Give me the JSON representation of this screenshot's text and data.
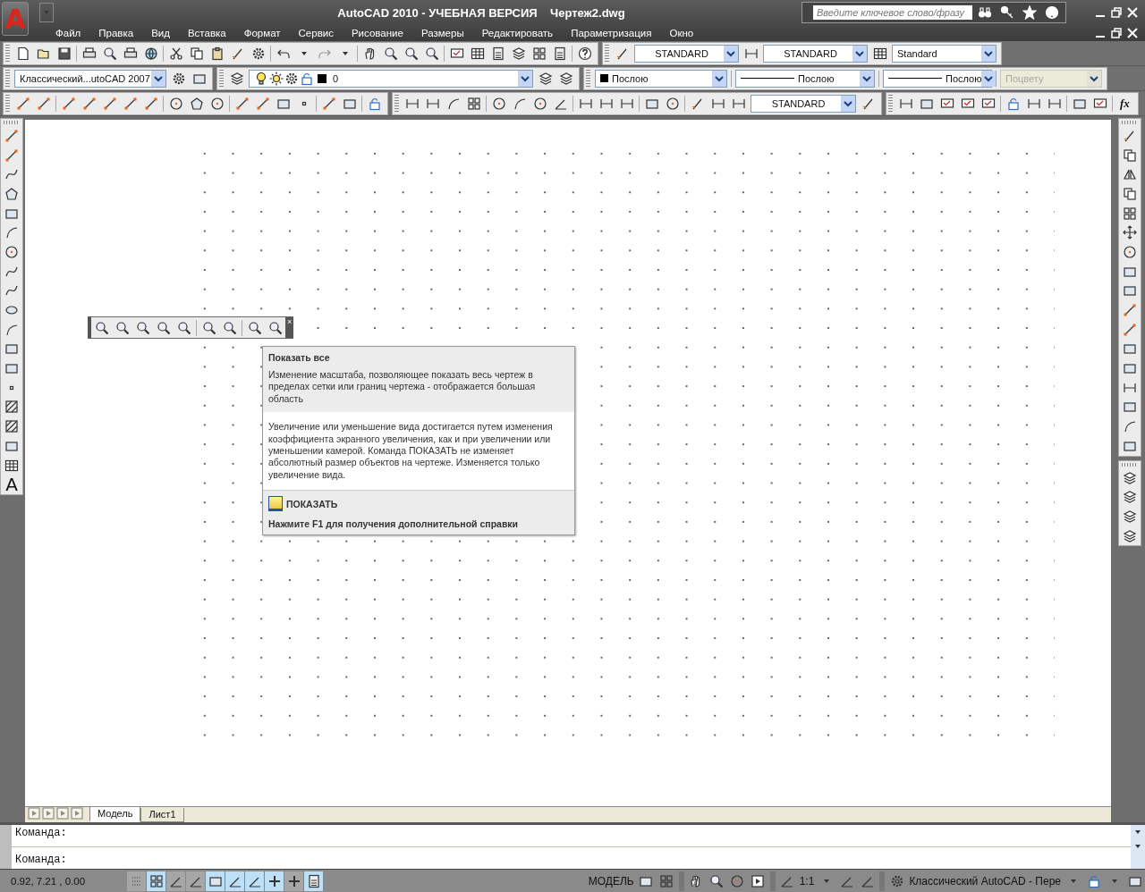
{
  "title_bar": {
    "app_logo": "A",
    "title": "AutoCAD 2010 - УЧЕБНАЯ ВЕРСИЯ",
    "document": "Чертеж2.dwg",
    "search": {
      "placeholder": "Введите ключевое слово/фразу"
    }
  },
  "menu": [
    "Файл",
    "Правка",
    "Вид",
    "Вставка",
    "Формат",
    "Сервис",
    "Рисование",
    "Размеры",
    "Редактировать",
    "Параметризация",
    "Окно"
  ],
  "styles_toolbar": {
    "text_style": "STANDARD",
    "dim_style": "STANDARD",
    "table_style": "Standard"
  },
  "workspace_toolbar": {
    "workspace": "Классический...utoCAD 2007"
  },
  "layers_toolbar": {
    "layer": "0"
  },
  "properties_toolbar": {
    "color_setting": "Послою",
    "linetype": "Послою",
    "lineweight": "Послою",
    "plot_style": {
      "value": "Поцвету",
      "disabled": true
    }
  },
  "dimension_toolbar": {
    "dim_style": "STANDARD"
  },
  "parametric_toolbar": {
    "function_label": "fx"
  },
  "draw_toolbar": {
    "text_tool": "A"
  },
  "zoom_toolbar": {
    "close": "×"
  },
  "tooltip": {
    "title": "Показать все",
    "description": "Изменение масштаба, позволяющее показать весь чертеж в пределах сетки или границ чертежа - отображается большая область",
    "details": "Увеличение или уменьшение вида достигается путем изменения коэффициента экранного увеличения, как и при увеличении или уменьшении камерой. Команда ПОКАЗАТЬ не изменяет абсолютный размер объектов на чертеже. Изменяется только увеличение вида.",
    "command": "ПОКАЗАТЬ",
    "help": "Нажмите F1 для получения дополнительной справки"
  },
  "layout_tabs": [
    {
      "label": "Модель",
      "selected": true
    },
    {
      "label": "Лист1",
      "selected": false
    }
  ],
  "command_lines": [
    "Команда:",
    "Команда:"
  ],
  "status_bar": {
    "coordinates": "0.92, 7.21 , 0.00",
    "toggles": [
      {
        "kind": "snap",
        "on": false
      },
      {
        "kind": "grid",
        "on": true
      },
      {
        "kind": "ortho",
        "on": false
      },
      {
        "kind": "polar",
        "on": false
      },
      {
        "kind": "osnap",
        "on": true
      },
      {
        "kind": "otrack",
        "on": true
      },
      {
        "kind": "ducs",
        "on": true
      },
      {
        "kind": "dyn",
        "on": true
      },
      {
        "kind": "lwt",
        "on": false
      },
      {
        "kind": "qp",
        "on": true
      }
    ],
    "space": "МОДЕЛЬ",
    "annotation_scale": "1:1",
    "workspace": "Классический AutoCAD - Пере"
  }
}
